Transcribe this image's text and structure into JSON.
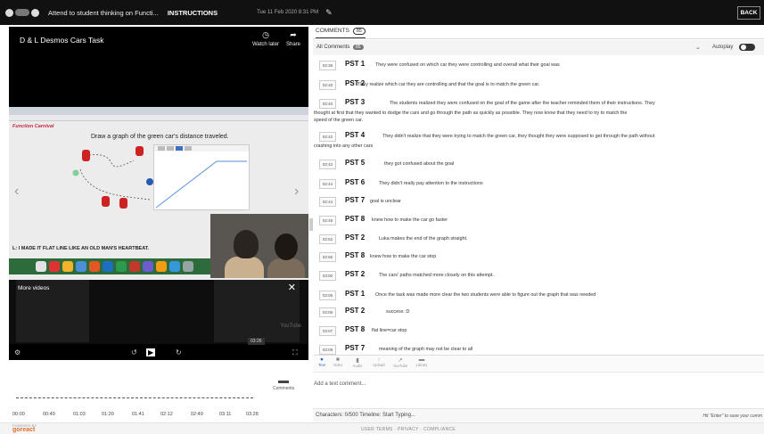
{
  "topbar": {
    "title": "Attend to student thinking on Functi...",
    "instructions": "INSTRUCTIONS",
    "date": "Tue 11 Feb 2020 8:31 PM",
    "back": "BACK"
  },
  "video": {
    "title": "D & L Desmos Cars Task",
    "watch_later": "Watch later",
    "share": "Share",
    "brand": "Function Carnival",
    "prompt": "Draw a graph of the green car's distance traveled.",
    "caption": "L: I MADE IT FLAT LINE LIKE AN OLD MAN'S HEARTBEAT.",
    "more_videos": "More videos",
    "youtube": "YouTube",
    "time_tooltip": "03:26",
    "progress": 0.92
  },
  "timeline_ticks": [
    "00:00",
    "00:49",
    "01:03",
    "01:20",
    "01:41",
    "02:12",
    "02:49",
    "03:11",
    "03:28"
  ],
  "comments_label": "Comments",
  "panel": {
    "tab": "COMMENTS",
    "tab_count": "85",
    "all_comments": "All Comments",
    "all_count": "85",
    "autoplay": "Autoplay"
  },
  "comments": [
    {
      "time": "02:36",
      "who": "PST 1",
      "text": "They were confused on which car they were controlling and overall what their goal was"
    },
    {
      "time": "02:40",
      "who": "PST 2",
      "text": "They realize which car they are controlling and that the goal is to match the green car."
    },
    {
      "time": "02:40",
      "who": "PST 3",
      "text": "The students realized they were confused on the goal of the game after the teacher reminded them of their instructions. They",
      "text2": "thought at first that they wanted to dodge the cars and go through the path as quickly as possible. They now know that they need to try to match the",
      "text3": "speed of the green car."
    },
    {
      "time": "02:42",
      "who": "PST 4",
      "text": "They didn't realize that they were trying to match the green car, they thought they were supposed to get through the path without",
      "text2": "crashing into any other cars"
    },
    {
      "time": "02:42",
      "who": "PST 5",
      "text": "they got confused about the goal"
    },
    {
      "time": "02:44",
      "who": "PST 6",
      "text": "They didn't really pay attention to the instructions"
    },
    {
      "time": "02:44",
      "who": "PST 7",
      "text": "goal is unclear"
    },
    {
      "time": "02:49",
      "who": "PST 8",
      "text": "knew how to make the car go faster"
    },
    {
      "time": "02:52",
      "who": "PST 2",
      "text": "Luka makes the end of the graph straight."
    },
    {
      "time": "02:56",
      "who": "PST 8",
      "text": "knew how to make the car stop"
    },
    {
      "time": "03:00",
      "who": "PST 2",
      "text": "The cars' paths matched more closely on this attempt."
    },
    {
      "time": "03:05",
      "who": "PST 1",
      "text": "Once the task was made more clear the two students were able to figure out the graph that was needed"
    },
    {
      "time": "03:06",
      "who": "PST 2",
      "text": "success :D"
    },
    {
      "time": "03:07",
      "who": "PST 8",
      "text": "flat line=car stop"
    },
    {
      "time": "03:09",
      "who": "PST 7",
      "text": "meaning of the graph may not be clear to all"
    }
  ],
  "toolbar": {
    "text": "Text",
    "video": "Video",
    "audio": "Audio",
    "upload": "Upload",
    "youtube": "YouTube",
    "library": "Library"
  },
  "input": {
    "placeholder": "Add a text comment..."
  },
  "status": {
    "left": "Characters: 0/500   Timeline:  Start Typing...",
    "right": "Hit \"Enter\" to save your comm"
  },
  "footer": {
    "powered": "POWERED BY",
    "logo": "goreact",
    "links": "USER TERMS  ·  PRIVACY  ·  COMPLIANCE"
  },
  "colors": {
    "accent": "#2a68c4",
    "brand": "#d96e2b",
    "topbar": "#111111"
  }
}
